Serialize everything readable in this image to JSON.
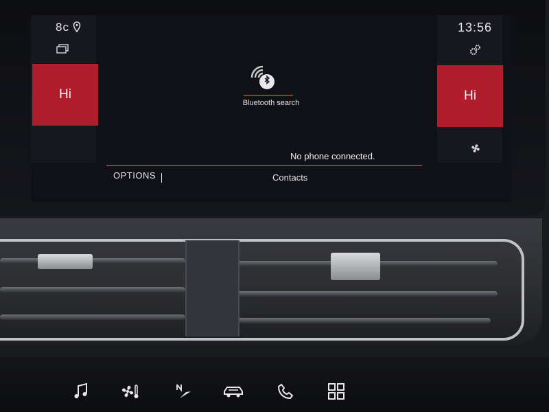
{
  "status": {
    "left_top": "8c",
    "clock": "13:56"
  },
  "tiles": {
    "left_label": "Hi",
    "right_label": "Hi"
  },
  "bluetooth": {
    "label": "Bluetooth search"
  },
  "message": "No phone connected.",
  "bottom_bar": {
    "options_label": "OPTIONS",
    "contacts_label": "Contacts"
  },
  "colors": {
    "accent_red": "#b01e2c",
    "divider_red": "#c42032"
  },
  "icons": {
    "location": "location-pin-icon",
    "screens": "screens-icon",
    "settings": "settings-gear-icon",
    "fan": "fan-icon",
    "bluetooth": "bluetooth-icon",
    "music": "music-icon",
    "climate": "climate-icon",
    "navigation": "navigation-icon",
    "car": "car-icon",
    "phone": "phone-icon",
    "apps": "apps-grid-icon"
  }
}
